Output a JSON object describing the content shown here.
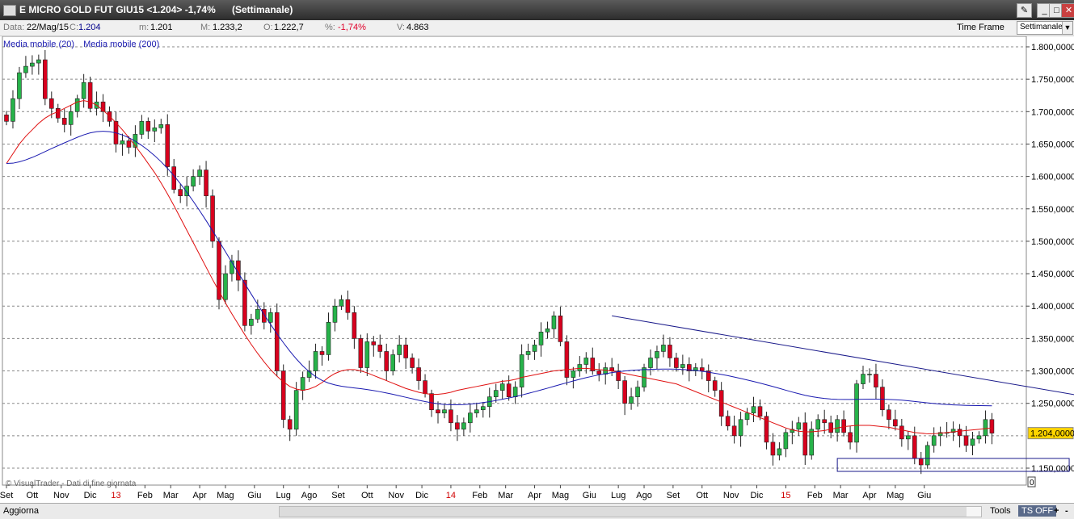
{
  "window": {
    "title": "E MICRO GOLD FUT GIU15 <1.204> -1,74%",
    "period": "(Settimanale)",
    "buttons": [
      "tool-icon",
      "minimize-icon",
      "maximize-icon",
      "close-icon"
    ]
  },
  "infobar": {
    "data_label": "Data:",
    "data_value": "22/Mag/15",
    "c_label": "C:",
    "c_value": "1.204",
    "m_label": "m:",
    "m_value": "1.201",
    "M_label": "M:",
    "M_value": "1.233,2",
    "o_label": "O:",
    "o_value": "1.222,7",
    "pct_label": "%:",
    "pct_value": "-1,74%",
    "v_label": "V:",
    "v_value": "4.863",
    "timeframe_label": "Time Frame",
    "timeframe_value": "Settimanale"
  },
  "legend": {
    "ma20": "Media mobile (20)",
    "ma200": "Media mobile (200)"
  },
  "watermark": "© VisualTrader - Dati di fine giornata",
  "footer": {
    "refresh": "Aggiorna",
    "tools": "Tools",
    "ts": "TS OFF",
    "plus": "+",
    "minus": "-"
  },
  "chart_data": {
    "type": "candlestick",
    "ylim": [
      1140,
      1810
    ],
    "yticks": [
      "1.800,0000",
      "1.750,0000",
      "1.700,0000",
      "1.650,0000",
      "1.600,0000",
      "1.550,0000",
      "1.500,0000",
      "1.450,0000",
      "1.400,0000",
      "1.350,0000",
      "1.300,0000",
      "1.250,0000",
      "1.150,0000"
    ],
    "ytick_values": [
      1800,
      1750,
      1700,
      1650,
      1600,
      1550,
      1500,
      1450,
      1400,
      1350,
      1300,
      1250,
      1150
    ],
    "last_price_label": "1.204,0000",
    "last_price": 1204,
    "zero_label": "0",
    "xlabels": [
      {
        "t": "Set",
        "w": 0,
        "red": false
      },
      {
        "t": "Ott",
        "w": 4,
        "red": false
      },
      {
        "t": "Nov",
        "w": 8.5,
        "red": false
      },
      {
        "t": "Dic",
        "w": 13,
        "red": false
      },
      {
        "t": "13",
        "w": 17,
        "red": true
      },
      {
        "t": "Feb",
        "w": 21.5,
        "red": false
      },
      {
        "t": "Mar",
        "w": 25.5,
        "red": false
      },
      {
        "t": "Apr",
        "w": 30,
        "red": false
      },
      {
        "t": "Mag",
        "w": 34,
        "red": false
      },
      {
        "t": "Giu",
        "w": 38.5,
        "red": false
      },
      {
        "t": "Lug",
        "w": 43,
        "red": false
      },
      {
        "t": "Ago",
        "w": 47,
        "red": false
      },
      {
        "t": "Set",
        "w": 51.5,
        "red": false
      },
      {
        "t": "Ott",
        "w": 56,
        "red": false
      },
      {
        "t": "Nov",
        "w": 60.5,
        "red": false
      },
      {
        "t": "Dic",
        "w": 64.5,
        "red": false
      },
      {
        "t": "14",
        "w": 69,
        "red": true
      },
      {
        "t": "Feb",
        "w": 73.5,
        "red": false
      },
      {
        "t": "Mar",
        "w": 77.5,
        "red": false
      },
      {
        "t": "Apr",
        "w": 82,
        "red": false
      },
      {
        "t": "Mag",
        "w": 86,
        "red": false
      },
      {
        "t": "Giu",
        "w": 90.5,
        "red": false
      },
      {
        "t": "Lug",
        "w": 95,
        "red": false
      },
      {
        "t": "Ago",
        "w": 99,
        "red": false
      },
      {
        "t": "Set",
        "w": 103.5,
        "red": false
      },
      {
        "t": "Ott",
        "w": 108,
        "red": false
      },
      {
        "t": "Nov",
        "w": 112.5,
        "red": false
      },
      {
        "t": "Dic",
        "w": 116.5,
        "red": false
      },
      {
        "t": "15",
        "w": 121,
        "red": true
      },
      {
        "t": "Feb",
        "w": 125.5,
        "red": false
      },
      {
        "t": "Mar",
        "w": 129.5,
        "red": false
      },
      {
        "t": "Apr",
        "w": 134,
        "red": false
      },
      {
        "t": "Mag",
        "w": 138,
        "red": false
      },
      {
        "t": "Giu",
        "w": 142.5,
        "red": false
      }
    ],
    "closes": [
      1685,
      1720,
      1760,
      1770,
      1775,
      1780,
      1720,
      1705,
      1690,
      1680,
      1700,
      1720,
      1745,
      1705,
      1715,
      1700,
      1685,
      1650,
      1655,
      1645,
      1665,
      1685,
      1670,
      1675,
      1680,
      1615,
      1580,
      1570,
      1585,
      1600,
      1610,
      1570,
      1500,
      1410,
      1450,
      1470,
      1440,
      1370,
      1380,
      1395,
      1375,
      1390,
      1300,
      1225,
      1210,
      1270,
      1290,
      1300,
      1330,
      1325,
      1375,
      1400,
      1410,
      1390,
      1350,
      1305,
      1345,
      1340,
      1330,
      1300,
      1325,
      1340,
      1320,
      1305,
      1285,
      1265,
      1240,
      1235,
      1240,
      1220,
      1210,
      1220,
      1235,
      1240,
      1245,
      1260,
      1270,
      1280,
      1260,
      1275,
      1325,
      1330,
      1340,
      1360,
      1365,
      1385,
      1345,
      1290,
      1300,
      1310,
      1320,
      1300,
      1295,
      1305,
      1300,
      1285,
      1250,
      1260,
      1275,
      1305,
      1320,
      1330,
      1340,
      1320,
      1305,
      1310,
      1300,
      1305,
      1300,
      1285,
      1270,
      1230,
      1215,
      1200,
      1225,
      1235,
      1245,
      1230,
      1190,
      1170,
      1180,
      1205,
      1210,
      1220,
      1170,
      1210,
      1225,
      1220,
      1205,
      1225,
      1205,
      1190,
      1280,
      1295,
      1295,
      1275,
      1240,
      1225,
      1215,
      1195,
      1200,
      1165,
      1155,
      1185,
      1200,
      1205,
      1205,
      1210,
      1200,
      1185,
      1195,
      1200,
      1225,
      1204
    ],
    "ma20": [
      1620,
      1635,
      1650,
      1662,
      1672,
      1682,
      1690,
      1696,
      1700,
      1705,
      1710,
      1715,
      1717,
      1715,
      1710,
      1702,
      1693,
      1683,
      1672,
      1660,
      1647,
      1634,
      1620,
      1606,
      1590,
      1573,
      1555,
      1536,
      1517,
      1498,
      1479,
      1460,
      1441,
      1423,
      1405,
      1388,
      1372,
      1356,
      1341,
      1327,
      1314,
      1302,
      1292,
      1283,
      1276,
      1272,
      1270,
      1272,
      1276,
      1282,
      1290,
      1296,
      1300,
      1302,
      1302,
      1300,
      1297,
      1293,
      1289,
      1285,
      1281,
      1277,
      1273,
      1270,
      1267,
      1265,
      1264,
      1264,
      1265,
      1267,
      1270,
      1272,
      1274,
      1276,
      1278,
      1280,
      1282,
      1284,
      1285,
      1287,
      1290,
      1292,
      1294,
      1296,
      1298,
      1300,
      1301,
      1302,
      1303,
      1304,
      1304,
      1303,
      1302,
      1301,
      1300,
      1298,
      1296,
      1294,
      1292,
      1290,
      1288,
      1286,
      1284,
      1282,
      1280,
      1276,
      1272,
      1268,
      1264,
      1260,
      1256,
      1252,
      1248,
      1244,
      1240,
      1236,
      1232,
      1228,
      1224,
      1220,
      1216,
      1212,
      1209,
      1207,
      1206,
      1206,
      1207,
      1208,
      1210,
      1212,
      1214,
      1215,
      1216,
      1216,
      1216,
      1215,
      1214,
      1213,
      1211,
      1209,
      1207,
      1205,
      1204,
      1203,
      1203,
      1204,
      1205,
      1206,
      1207,
      1208,
      1209,
      1210,
      1211,
      1212
    ],
    "trendline": {
      "from": [
        94,
        1385
      ],
      "to": [
        169,
        1258
      ]
    },
    "support_box": {
      "x0": 129,
      "x1": 165,
      "y0": 1145,
      "y1": 1165
    }
  }
}
